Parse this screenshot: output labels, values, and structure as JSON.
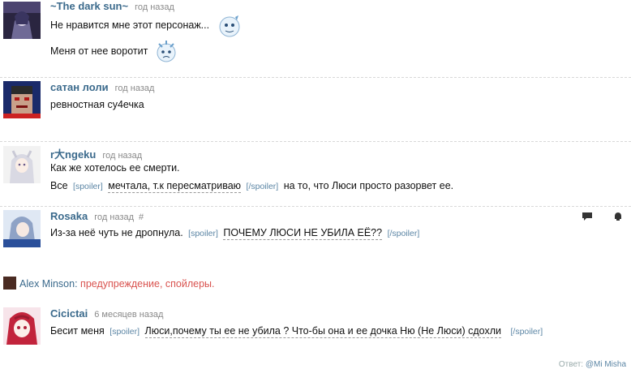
{
  "comments": [
    {
      "author": "~The dark sun~",
      "time": "год назад",
      "lines": [
        "Не нравится мне этот персонаж...",
        "Меня от нее воротит"
      ]
    },
    {
      "author": "сатан лоли",
      "time": "год назад",
      "lines": [
        "ревностная су4ечка"
      ]
    },
    {
      "author": "r大ngeku",
      "time": "год назад",
      "line1": "Как же хотелось ее смерти.",
      "line2": {
        "before": "Все",
        "spoiler_open": "[spoiler]",
        "spoiler_text": "мечтала, т.к пересматриваю",
        "spoiler_close": "[/spoiler]",
        "after": "на то, что Люси просто разорвет ее."
      }
    },
    {
      "author": "Rosaka",
      "time": "год назад",
      "hash": "#",
      "before": "Из-за неё чуть не дропнула.",
      "spoiler_open": "[spoiler]",
      "spoiler_text": "ПОЧЕМУ ЛЮСИ НЕ УБИЛА ЕЁ??",
      "spoiler_close": "[/spoiler]"
    },
    {
      "author": "Cicictai",
      "time": "6 месяцев назад",
      "before": "Бесит меня",
      "spoiler_open": "[spoiler]",
      "spoiler_text": "Люси,почему ты ее не убила ? Что-бы она и ее дочка Ню (Не Люси) сдохли",
      "spoiler_close": "[/spoiler]"
    }
  ],
  "warning": {
    "author": "Alex Minson",
    "text": "предупреждение, спойлеры."
  },
  "footer": {
    "label": "Ответ:",
    "user": "@Mi Misha"
  },
  "colors": {
    "author": "#3b6a8c",
    "tag": "#5c86a5",
    "warning": "#d9534f"
  }
}
